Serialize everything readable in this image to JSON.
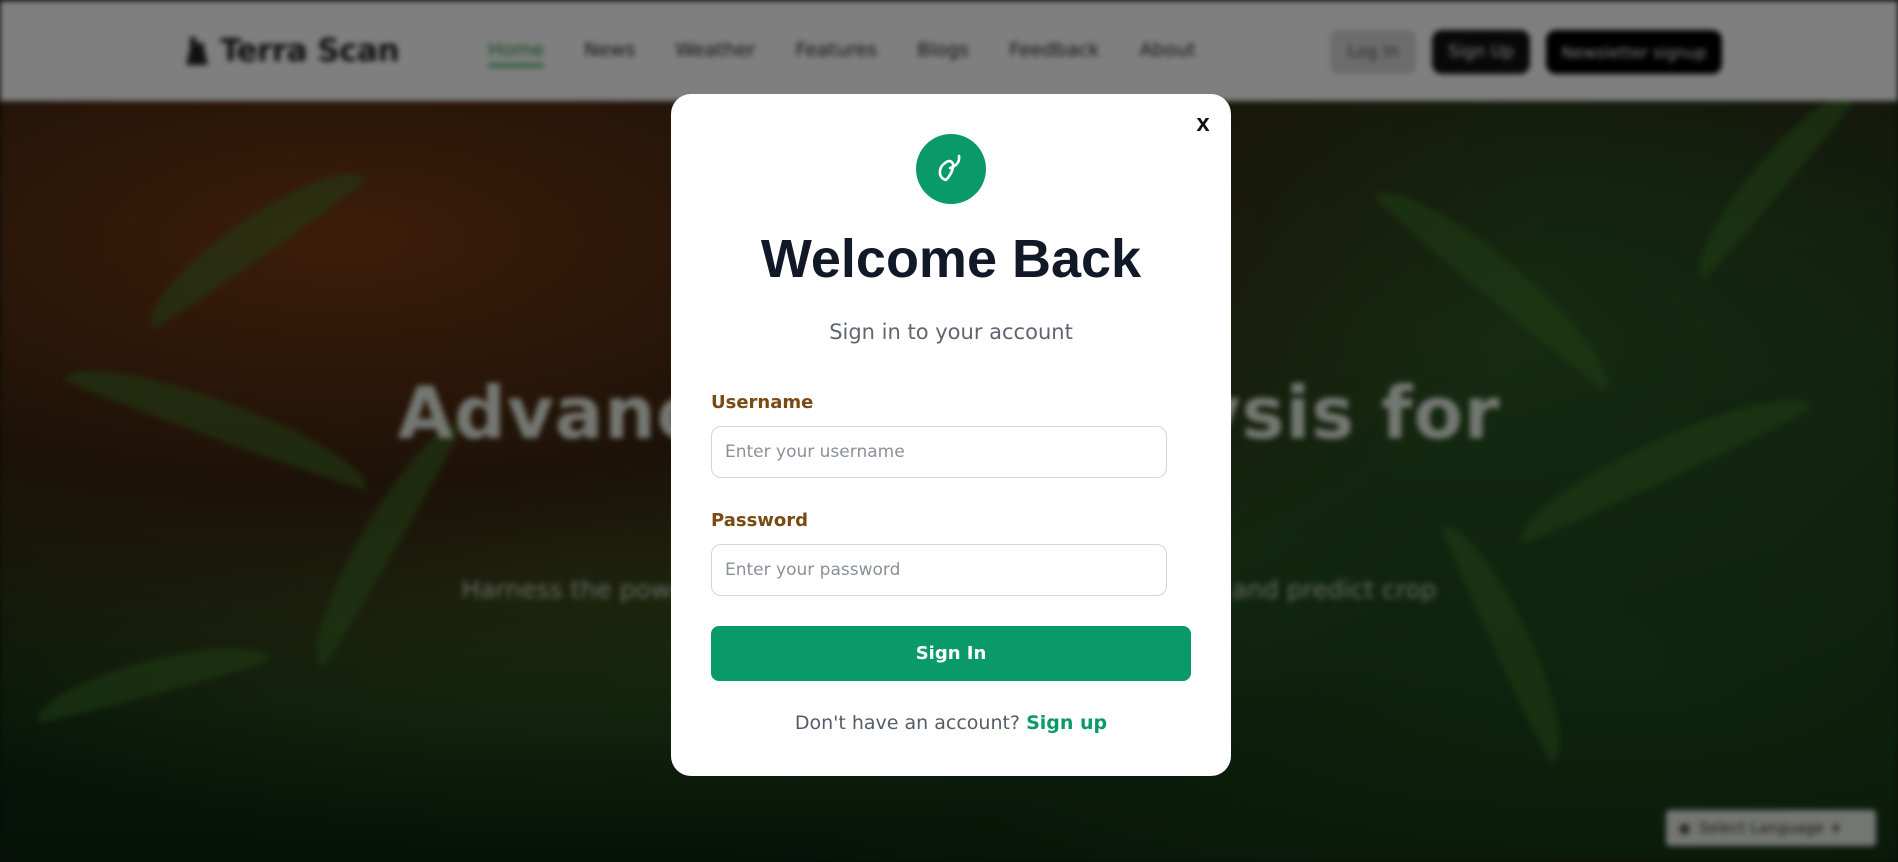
{
  "header": {
    "brand": "Terra Scan",
    "nav": [
      {
        "label": "Home",
        "active": true
      },
      {
        "label": "News"
      },
      {
        "label": "Weather"
      },
      {
        "label": "Features"
      },
      {
        "label": "Blogs"
      },
      {
        "label": "Feedback"
      },
      {
        "label": "About"
      }
    ],
    "login_label": "Log In",
    "signup_label": "Sign Up",
    "newsletter_label": "Newsletter signup"
  },
  "hero": {
    "title": "Advanced Soil Analysis for",
    "subtitle": "Harness the power of technology to analyze soil composition and predict crop suitability with precision and efficiency."
  },
  "language_widget": {
    "label": "Select Language"
  },
  "modal": {
    "close_label": "x",
    "title": "Welcome Back",
    "subtitle": "Sign in to your account",
    "username_label": "Username",
    "username_placeholder": "Enter your username",
    "password_label": "Password",
    "password_placeholder": "Enter your password",
    "signin_label": "Sign In",
    "footer_text": "Don't have an account?",
    "signup_link": "Sign up"
  },
  "colors": {
    "accent": "#0a9a6a",
    "label": "#7a4a12",
    "title": "#111827"
  },
  "icons": {
    "logo": "leaf-icon",
    "brand": "soil-icon"
  }
}
